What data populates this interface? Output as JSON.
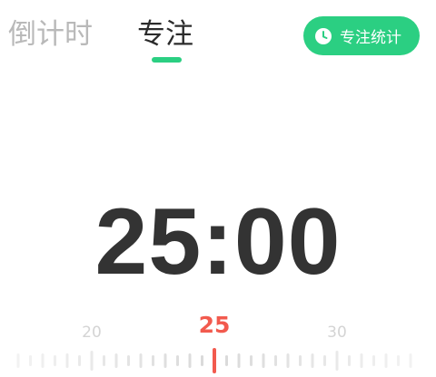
{
  "tabs": {
    "countdown_label": "倒计时",
    "focus_label": "专注",
    "active": "focus"
  },
  "stats_button": {
    "label": "专注统计",
    "icon": "clock-icon"
  },
  "timer": {
    "display": "25:00"
  },
  "ruler": {
    "selected_minutes": 25,
    "selected_label": "25",
    "min_visible": 17,
    "max_visible": 33,
    "ticks_per_minute": 2,
    "major_labels": [
      {
        "value": 20,
        "label": "20"
      },
      {
        "value": 30,
        "label": "30"
      }
    ]
  },
  "colors": {
    "accent": "#2bcf82",
    "selected": "#f25a4e",
    "inactive_text": "#b9b9b9",
    "primary_text": "#333333",
    "tick": "#d9d9d9",
    "tick_label": "#d4d4d4"
  }
}
